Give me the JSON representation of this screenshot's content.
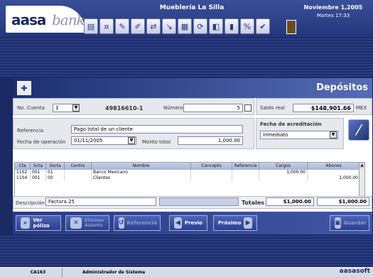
{
  "header": {
    "logo_part1": "aasa",
    "logo_part2": "bank",
    "company": "Mueblería La Silla",
    "date": "Noviembre 1,2005",
    "time": "Martes 17:33"
  },
  "title": {
    "text": "Depósitos"
  },
  "form": {
    "no_cuenta_label": "No. Cuenta",
    "no_cuenta_value": "1",
    "account_number": "49816610-1",
    "numero_label": "Número",
    "numero_value": "5",
    "saldo_label": "Saldo real",
    "saldo_value": "$148,901.66",
    "currency": "MEX",
    "referencia_label": "Referencia",
    "referencia_value": "Pago total de un cliente",
    "fecha_op_label": "Fecha de operación",
    "fecha_op_value": "01/11/2005",
    "monto_label": "Monto total",
    "monto_value": "1,000.00",
    "fecha_acred_label": "Fecha de acreditación",
    "fecha_acred_value": "Inmediato"
  },
  "table": {
    "columns": [
      "Cta",
      "Scta",
      "Sscta",
      "Centro",
      "Nombre",
      "Concepto",
      "Referencia",
      "Cargos",
      "Abonos"
    ],
    "rows": [
      [
        "1102",
        "001",
        "01",
        "",
        "Banco Mexicano",
        "",
        "",
        "1,000.00",
        ""
      ],
      [
        "1104",
        "001",
        "00",
        "",
        "Clientes",
        "",
        "",
        "",
        "1,000.00"
      ]
    ]
  },
  "footer": {
    "descripcion_label": "Descripción",
    "descripcion_value": "Factura 25",
    "totales_label": "Totales",
    "total_cargos": "$1,000.00",
    "total_abonos": "$1,000.00"
  },
  "buttons": {
    "ver_poliza": "Ver póliza",
    "eliminar_line1": "Eliminar",
    "eliminar_line2": "Asiento",
    "referencia": "Referencia",
    "previo": "Previo",
    "proximo": "Próximo",
    "guardar": "Guardar"
  },
  "status": {
    "code": "CA163",
    "user": "Administrador de Sistema",
    "brand": "aasasoft"
  }
}
